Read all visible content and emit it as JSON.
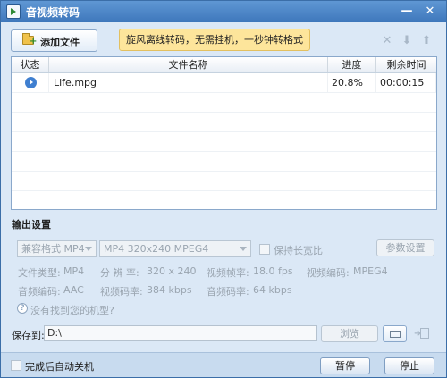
{
  "window": {
    "title": "音视频转码"
  },
  "titlebar": {
    "minimize_glyph": "—",
    "close_glyph": "✕"
  },
  "toolbar": {
    "add_file_label": "添加文件",
    "promo_text": "旋风离线转码，无需挂机，一秒钟转格式",
    "icons": [
      "delete-icon",
      "move-down-icon",
      "move-up-icon"
    ]
  },
  "table": {
    "columns": {
      "status": "状态",
      "name": "文件名称",
      "progress": "进度",
      "remaining": "剩余时间"
    },
    "rows": [
      {
        "name": "Life.mpg",
        "progress": "20.8%",
        "remaining": "00:00:15"
      }
    ]
  },
  "output": {
    "section_title": "输出设置",
    "format_select": "兼容格式 MP4",
    "preset_select": "MP4 320x240 MPEG4",
    "keep_ratio_label": "保持长宽比",
    "param_button": "参数设置",
    "info": {
      "file_type_label": "文件类型:",
      "file_type_value": "MP4",
      "resolution_label": "分 辨 率:",
      "resolution_value": "320 x 240",
      "frame_rate_label": "视频帧率:",
      "frame_rate_value": "18.0 fps",
      "video_codec_label": "视频编码:",
      "video_codec_value": "MPEG4",
      "audio_codec_label": "音频编码:",
      "audio_codec_value": "AAC",
      "video_bitrate_label": "视频码率:",
      "video_bitrate_value": "384 kbps",
      "audio_bitrate_label": "音频码率:",
      "audio_bitrate_value": "64 kbps"
    },
    "help_glyph": "?",
    "help_text": "没有找到您的机型?"
  },
  "save": {
    "label": "保存到:",
    "path": "D:\\",
    "browse_button": "浏览"
  },
  "bottom": {
    "auto_shutdown_label": "完成后自动关机",
    "pause_button": "暂停",
    "stop_button": "停止"
  },
  "colors": {
    "titlebar": "#3e77bb",
    "window_bg": "#dbe8f6",
    "promo_bg": "#fde59b",
    "status_icon": "#3f7fd0"
  }
}
